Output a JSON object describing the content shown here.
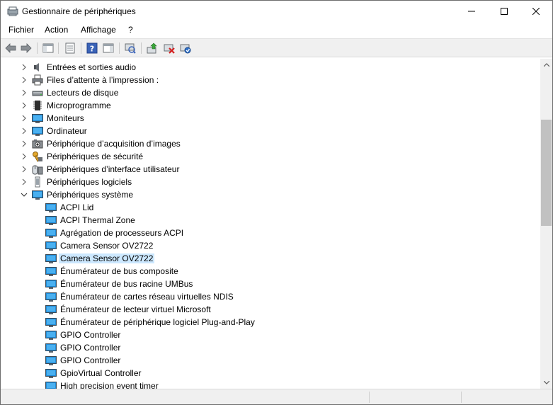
{
  "window": {
    "title": "Gestionnaire de périphériques"
  },
  "menu": [
    "Fichier",
    "Action",
    "Affichage",
    "?"
  ],
  "toolbar": {
    "buttons": [
      "back-arrow",
      "forward-arrow",
      "show-hide-console-tree",
      "properties",
      "help",
      "action-pane",
      "scan-for-hardware-changes",
      "update-driver",
      "uninstall-device",
      "enable-device"
    ]
  },
  "tree": {
    "categories": [
      {
        "label": "Entrées et sorties audio",
        "icon": "speaker-icon",
        "expanded": false
      },
      {
        "label": "Files d’attente à l’impression :",
        "icon": "printer-icon",
        "expanded": false
      },
      {
        "label": "Lecteurs de disque",
        "icon": "disk-drive-icon",
        "expanded": false
      },
      {
        "label": "Microprogramme",
        "icon": "firmware-icon",
        "expanded": false
      },
      {
        "label": "Moniteurs",
        "icon": "monitor-icon",
        "expanded": false
      },
      {
        "label": "Ordinateur",
        "icon": "computer-icon",
        "expanded": false
      },
      {
        "label": "Périphérique d’acquisition d’images",
        "icon": "camera-icon",
        "expanded": false
      },
      {
        "label": "Périphériques de sécurité",
        "icon": "security-key-icon",
        "expanded": false
      },
      {
        "label": "Périphériques d’interface utilisateur",
        "icon": "hid-icon",
        "expanded": false
      },
      {
        "label": "Périphériques logiciels",
        "icon": "software-device-icon",
        "expanded": false
      },
      {
        "label": "Périphériques système",
        "icon": "system-device-icon",
        "expanded": true
      }
    ],
    "system_devices": [
      {
        "label": "ACPI Lid",
        "selected": false
      },
      {
        "label": "ACPI Thermal Zone",
        "selected": false
      },
      {
        "label": "Agrégation de processeurs ACPI",
        "selected": false
      },
      {
        "label": "Camera Sensor OV2722",
        "selected": false
      },
      {
        "label": "Camera Sensor OV2722",
        "selected": true
      },
      {
        "label": "Énumérateur de bus composite",
        "selected": false
      },
      {
        "label": "Énumérateur de bus racine UMBus",
        "selected": false
      },
      {
        "label": "Énumérateur de cartes réseau virtuelles NDIS",
        "selected": false
      },
      {
        "label": "Énumérateur de lecteur virtuel Microsoft",
        "selected": false
      },
      {
        "label": "Énumérateur de périphérique logiciel Plug-and-Play",
        "selected": false
      },
      {
        "label": "GPIO Controller",
        "selected": false
      },
      {
        "label": "GPIO Controller",
        "selected": false
      },
      {
        "label": "GPIO Controller",
        "selected": false
      },
      {
        "label": "GpioVirtual Controller",
        "selected": false
      },
      {
        "label": "High precision event timer",
        "selected": false
      }
    ]
  },
  "colors": {
    "selection": "#cce8ff",
    "toolbar_bg": "#f0f0f0",
    "monitor_blue": "#1e8ad6"
  }
}
